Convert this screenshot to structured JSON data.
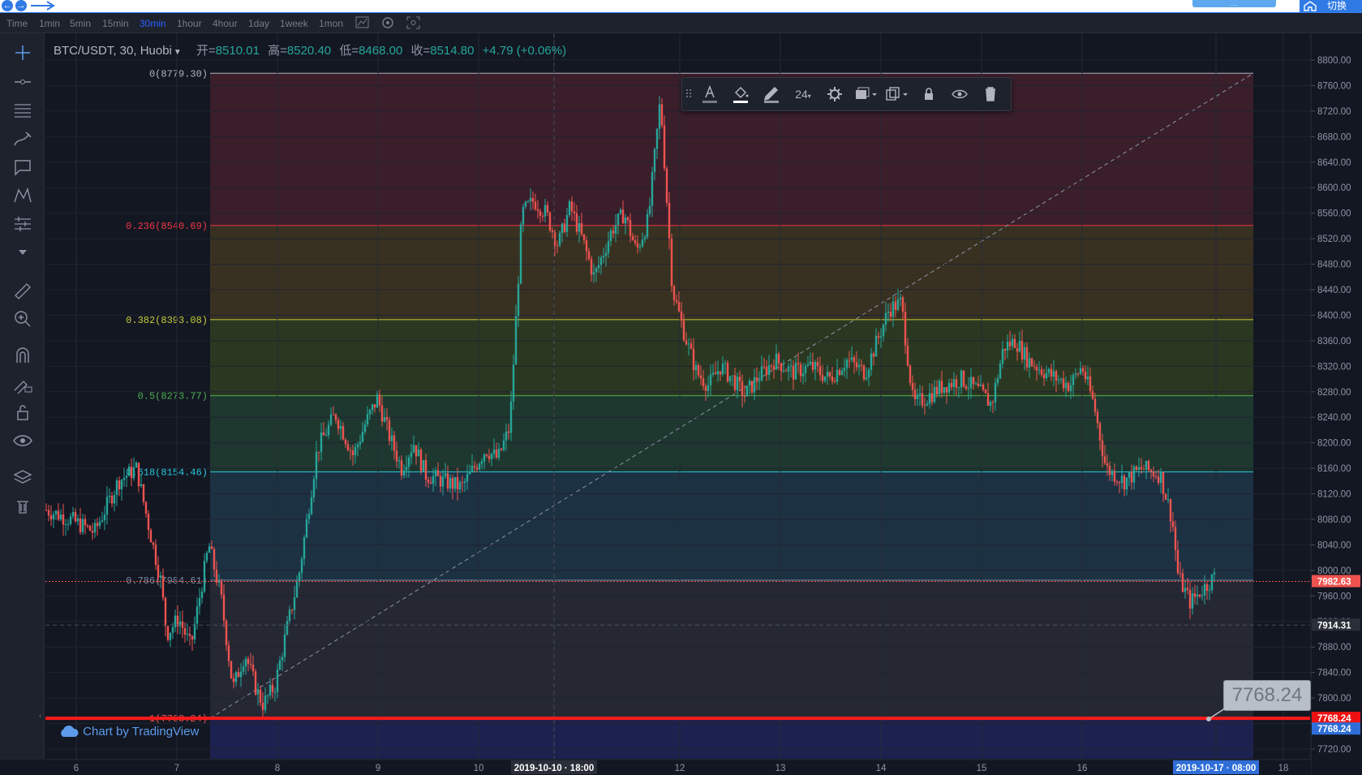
{
  "window": {
    "nav_back": "←",
    "nav_forward": "→",
    "switch_label": "切换",
    "blue_button": "…"
  },
  "timeframes": {
    "items": [
      "Time",
      "1min",
      "5min",
      "15min",
      "30min",
      "1hour",
      "4hour",
      "1day",
      "1week",
      "1mon"
    ],
    "active": "30min"
  },
  "symbol": {
    "name": "BTC/USDT, 30, Huobi",
    "open_label": "开=",
    "open": "8510.01",
    "high_label": "高=",
    "high": "8520.40",
    "low_label": "低=",
    "low": "8468.00",
    "close_label": "收=",
    "close": "8514.80",
    "change": "+4.79 (+0.06%)"
  },
  "toolbar": {
    "font_size": "24"
  },
  "tooltip": {
    "value": "7768.24"
  },
  "branding": {
    "label": "Chart by TradingView"
  },
  "colors": {
    "up": "#26a69a",
    "down": "#ef5350",
    "background": "#131722",
    "accent": "#2962ff"
  },
  "chart_data": {
    "type": "candlestick",
    "symbol": "BTC/USDT",
    "interval": "30",
    "exchange": "Huobi",
    "x_ticks": [
      "6",
      "7",
      "8",
      "9",
      "10",
      "2019-10-10 · 18:00",
      "12",
      "13",
      "14",
      "15",
      "16",
      "2019-10-17 · 08:00",
      "18"
    ],
    "y_ticks": [
      "8800.00",
      "8760.00",
      "8720.00",
      "8680.00",
      "8640.00",
      "8600.00",
      "8560.00",
      "8520.00",
      "8480.00",
      "8440.00",
      "8400.00",
      "8360.00",
      "8320.00",
      "8280.00",
      "8240.00",
      "8200.00",
      "8160.00",
      "8120.00",
      "8080.00",
      "8040.00",
      "8000.00",
      "7960.00",
      "7920.00",
      "7880.00",
      "7840.00",
      "7800.00",
      "7760.00",
      "7720.00"
    ],
    "ylim": [
      7705,
      8825
    ],
    "fibonacci": [
      {
        "level": "0",
        "price": 8779.3,
        "label": "0(8779.30)",
        "color": "#b2b5be",
        "fill": "#3c1f2b"
      },
      {
        "level": "0.236",
        "price": 8540.69,
        "label": "0.236(8540.69)",
        "color": "#f23645",
        "fill": "#3a3322"
      },
      {
        "level": "0.382",
        "price": 8393.08,
        "label": "0.382(8393.08)",
        "color": "#c6cd3a",
        "fill": "#2c3a22"
      },
      {
        "level": "0.5",
        "price": 8273.77,
        "label": "0.5(8273.77)",
        "color": "#4caf50",
        "fill": "#1f3a30"
      },
      {
        "level": "0.618",
        "price": 8154.46,
        "label": "0.618(8154.46)",
        "color": "#26c6da",
        "fill": "#1c3344"
      },
      {
        "level": "0.786",
        "price": 7984.61,
        "label": "0.786(7984.61)",
        "color": "#7a8aa0",
        "fill": "#262935"
      },
      {
        "level": "1",
        "price": 7768.24,
        "label": "1(7768.24)",
        "color": "#ef5350",
        "fill": "#1c2252"
      }
    ],
    "price_labels": [
      {
        "price": 7982.63,
        "label": "7982.63",
        "bg": "#ef5350"
      },
      {
        "price": 7914.31,
        "label": "7914.31",
        "bg": "#2a2e39"
      },
      {
        "price": 7768.24,
        "label": "7768.24",
        "bg": "#ef1111"
      },
      {
        "price": 7751.5,
        "label": "7768.24",
        "bg": "#2f6ed8"
      }
    ],
    "horizontal_line": 7768.24,
    "path_points": [
      [
        0,
        8095
      ],
      [
        4,
        8080
      ],
      [
        8,
        8060
      ],
      [
        12,
        8140
      ],
      [
        15,
        8160
      ],
      [
        17,
        8070
      ],
      [
        19,
        7985
      ],
      [
        20,
        7900
      ],
      [
        22,
        7925
      ],
      [
        24,
        7880
      ],
      [
        27,
        8040
      ],
      [
        29,
        7960
      ],
      [
        31,
        7815
      ],
      [
        33,
        7870
      ],
      [
        35,
        7810
      ],
      [
        36,
        7790
      ],
      [
        38,
        7820
      ],
      [
        40,
        7910
      ],
      [
        42,
        7995
      ],
      [
        45,
        8190
      ],
      [
        48,
        8245
      ],
      [
        51,
        8180
      ],
      [
        53,
        8230
      ],
      [
        55,
        8270
      ],
      [
        57,
        8210
      ],
      [
        59,
        8160
      ],
      [
        61,
        8200
      ],
      [
        63,
        8150
      ],
      [
        66,
        8140
      ],
      [
        69,
        8130
      ],
      [
        71,
        8160
      ],
      [
        73,
        8190
      ],
      [
        75,
        8175
      ],
      [
        77,
        8225
      ],
      [
        79,
        8560
      ],
      [
        81,
        8580
      ],
      [
        83,
        8560
      ],
      [
        85,
        8510
      ],
      [
        87,
        8570
      ],
      [
        89,
        8520
      ],
      [
        91,
        8460
      ],
      [
        94,
        8535
      ],
      [
        96,
        8560
      ],
      [
        98,
        8500
      ],
      [
        100,
        8550
      ],
      [
        102,
        8740
      ],
      [
        104,
        8440
      ],
      [
        106,
        8370
      ],
      [
        108,
        8310
      ],
      [
        110,
        8290
      ],
      [
        112,
        8320
      ],
      [
        114,
        8300
      ],
      [
        116,
        8275
      ],
      [
        118,
        8300
      ],
      [
        121,
        8330
      ],
      [
        124,
        8310
      ],
      [
        127,
        8320
      ],
      [
        130,
        8300
      ],
      [
        133,
        8330
      ],
      [
        136,
        8310
      ],
      [
        138,
        8360
      ],
      [
        140,
        8410
      ],
      [
        142,
        8420
      ],
      [
        144,
        8260
      ],
      [
        146,
        8270
      ],
      [
        149,
        8290
      ],
      [
        152,
        8300
      ],
      [
        155,
        8280
      ],
      [
        157,
        8260
      ],
      [
        159,
        8350
      ],
      [
        161,
        8360
      ],
      [
        163,
        8330
      ],
      [
        166,
        8310
      ],
      [
        168,
        8300
      ],
      [
        170,
        8290
      ],
      [
        172,
        8320
      ],
      [
        174,
        8260
      ],
      [
        176,
        8160
      ],
      [
        179,
        8140
      ],
      [
        182,
        8160
      ],
      [
        185,
        8150
      ],
      [
        187,
        8080
      ],
      [
        188,
        7990
      ],
      [
        190,
        7950
      ],
      [
        192,
        7970
      ],
      [
        194,
        7990
      ]
    ]
  }
}
